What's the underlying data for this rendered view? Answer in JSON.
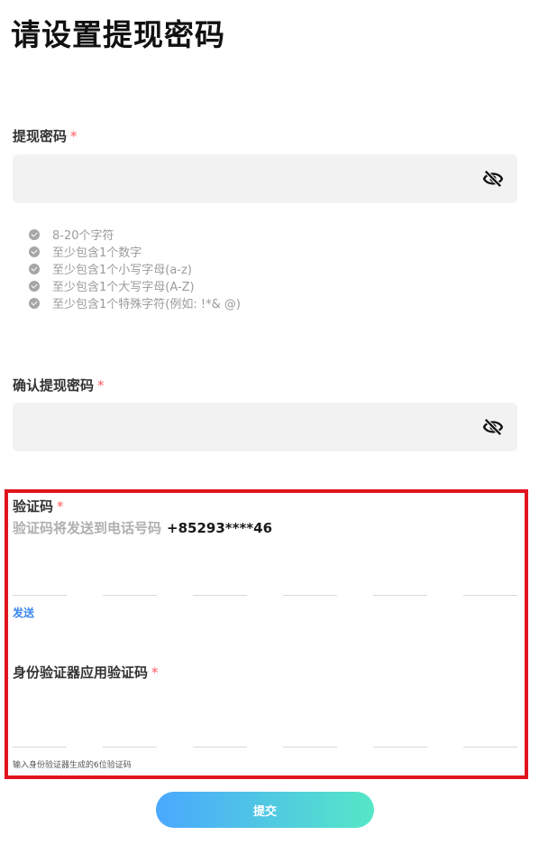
{
  "page": {
    "title": "请设置提现密码"
  },
  "password": {
    "label": "提现密码",
    "required_mark": "*"
  },
  "rules": [
    "8-20个字符",
    "至少包含1个数字",
    "至少包含1个小写字母(a-z)",
    "至少包含1个大写字母(A-Z)",
    "至少包含1个特殊字符(例如: !*& @)"
  ],
  "confirm": {
    "label": "确认提现密码",
    "required_mark": "*"
  },
  "sms": {
    "label": "验证码",
    "required_mark": "*",
    "hint": "验证码将发送到电话号码",
    "phone": "+85293****46",
    "send_label": "发送"
  },
  "authenticator": {
    "label": "身份验证器应用验证码",
    "required_mark": "*",
    "hint": "输入身份验证器生成的6位验证码"
  },
  "submit": {
    "label": "提交"
  },
  "colors": {
    "accent_link": "#3a86f0",
    "required": "#ff5a5f",
    "highlight_border": "#e0141e",
    "button_start": "#4aa8ff",
    "button_end": "#55e7c6"
  }
}
